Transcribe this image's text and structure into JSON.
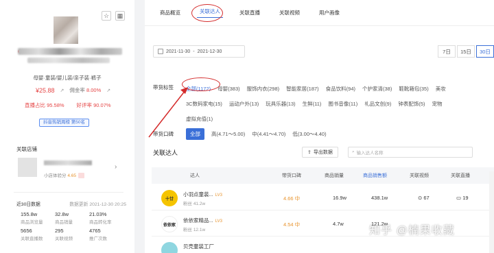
{
  "product": {
    "category": "母婴·童装/婴儿装/亲子装·裤子",
    "price": "¥25.88",
    "commission_label": "佣金率",
    "commission_value": "8.00%",
    "live_ratio_label": "直播占比",
    "live_ratio_value": "95.58%",
    "positive_rate_label": "好评率",
    "positive_rate_value": "90.07%",
    "rank_badge": "抖音热销周榜 第50名"
  },
  "shop": {
    "section_title": "关联店铺",
    "score_label": "小店体验分",
    "score_value": "4.65"
  },
  "stats": {
    "title": "近30日数据",
    "updated": "数据更新 2021-12-30 20:25",
    "items": [
      {
        "value": "155.8w",
        "label": "商品浏览量"
      },
      {
        "value": "32.8w",
        "label": "商品销量"
      },
      {
        "value": "21.03%",
        "label": "商品转化率"
      },
      {
        "value": "5656",
        "label": "关联直播数"
      },
      {
        "value": "295",
        "label": "关联视频"
      },
      {
        "value": "4765",
        "label": "推广次数"
      }
    ]
  },
  "tabs": [
    "商品概览",
    "关联达人",
    "关联直播",
    "关联视频",
    "用户画像"
  ],
  "active_tab": "关联达人",
  "date_range": {
    "start": "2021-11-30",
    "sep": "-",
    "end": "2021-12-30"
  },
  "range_buttons": [
    "7日",
    "15日",
    "30日"
  ],
  "filters": {
    "category_label": "带货标签",
    "categories_row1": [
      "全部(1172)",
      "母婴(383)",
      "服饰内衣(298)",
      "智能家居(187)",
      "食品饮料(94)",
      "个护家清(38)",
      "鞋靴箱包(35)",
      "美妆"
    ],
    "categories_row2": [
      "3C数码家电(15)",
      "运动户外(13)",
      "玩具乐器(13)",
      "生鲜(11)",
      "图书音像(11)",
      "礼品文创(9)",
      "钟表配饰(5)",
      "宠物"
    ],
    "categories_row3": [
      "虚拟充值(1)"
    ],
    "reputation_label": "带货口碑",
    "reputation_options": [
      "全部",
      "高(4.71～5.00)",
      "中(4.41～4.70)",
      "低(3.00～4.40)"
    ]
  },
  "related": {
    "title": "关联达人",
    "export_label": "导出数据",
    "search_placeholder": "输入达人名称"
  },
  "table": {
    "headers": [
      "达人",
      "带货口碑",
      "商品销量",
      "商品销售额",
      "关联视频",
      "关联直播"
    ],
    "rows": [
      {
        "name": "小羽点童装...",
        "level": "LV3",
        "fans_label": "粉丝",
        "fans": "41.2w",
        "reputation": "4.66 中",
        "sales": "16.9w",
        "revenue": "438.1w",
        "videos": "67",
        "lives": "19",
        "avatar_text": "十廿",
        "avatar_color": "#f5c400"
      },
      {
        "name": "依依家精品...",
        "level": "LV3",
        "fans_label": "粉丝",
        "fans": "12.1w",
        "reputation": "4.54 中",
        "sales": "4.7w",
        "revenue": "121.2w",
        "videos": "",
        "lives": "",
        "avatar_text": "依依家",
        "avatar_color": "#ffffff"
      },
      {
        "name": "贝壳童装工厂",
        "level": "",
        "fans_label": "",
        "fans": "",
        "reputation": "",
        "sales": "",
        "revenue": "",
        "videos": "",
        "lives": "",
        "avatar_text": "",
        "avatar_color": "#8fd6e0"
      }
    ]
  },
  "watermark": "知乎 @楠果收藏",
  "accent_color": "#3a6fd8",
  "highlight_color": "#d42b2b"
}
